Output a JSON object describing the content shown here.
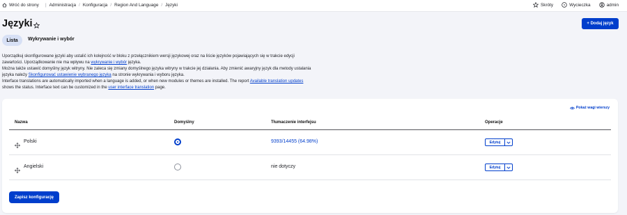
{
  "toolbar": {
    "back_label": "Wróć do strony",
    "breadcrumbs": [
      "Administracja",
      "Konfiguracja",
      "Region And Language",
      "Języki"
    ],
    "shortcuts_label": "Skróty",
    "tour_label": "Wycieczka",
    "user_label": "admin"
  },
  "header": {
    "title": "Języki",
    "add_button": "+ Dodaj język"
  },
  "tabs": [
    {
      "label": "Lista",
      "active": true
    },
    {
      "label": "Wykrywanie i wybór",
      "active": false
    }
  ],
  "description": {
    "p1_pre": "Uporządkuj skonfigurowane języki aby ustalić ich kolejność w bloku z przełącznikiem wersji językowej oraz na liście języków pojawiających się w trakcie edycji zawartości. Uporządkowanie nie ma wpływu na ",
    "p1_link": "wykrywanie i wybór",
    "p1_post": " języka.",
    "p2_pre": "Można także ustawić domyślny język witryny. Nie zaleca się zmiany domyślnego języka witryny w trakcie jej działania. Aby zmienić awaryjny język dla metody ustalania języka należy ",
    "p2_link": "Skonfigurować ustawienie wybranego języka",
    "p2_post": " na stronie wykrywania i wyboru języka.",
    "p3_pre": "Interface translations are automatically imported when a language is added, or when new modules or themes are installed. The report ",
    "p3_link1": "Available translation updates",
    "p3_mid": " shows the status. Interface text can be customized in the ",
    "p3_link2": "user interface translation",
    "p3_post": " page."
  },
  "table": {
    "show_weights": "Pokaż wagi wierszy",
    "columns": [
      "Nazwa",
      "Domyślny",
      "Tłumaczenie interfejsu",
      "Operacje"
    ],
    "rows": [
      {
        "name": "Polski",
        "default": true,
        "translation": "9393/14455 (64.98%)",
        "translation_is_link": true,
        "edit_label": "Edytuj"
      },
      {
        "name": "Angielski",
        "default": false,
        "translation": "nie dotyczy",
        "translation_is_link": false,
        "edit_label": "Edytuj"
      }
    ]
  },
  "save_button": "Zapisz konfigurację",
  "colors": {
    "accent": "#003ecc",
    "tab_active_bg": "#d7e0f5",
    "page_bg": "#f3f4f9"
  }
}
